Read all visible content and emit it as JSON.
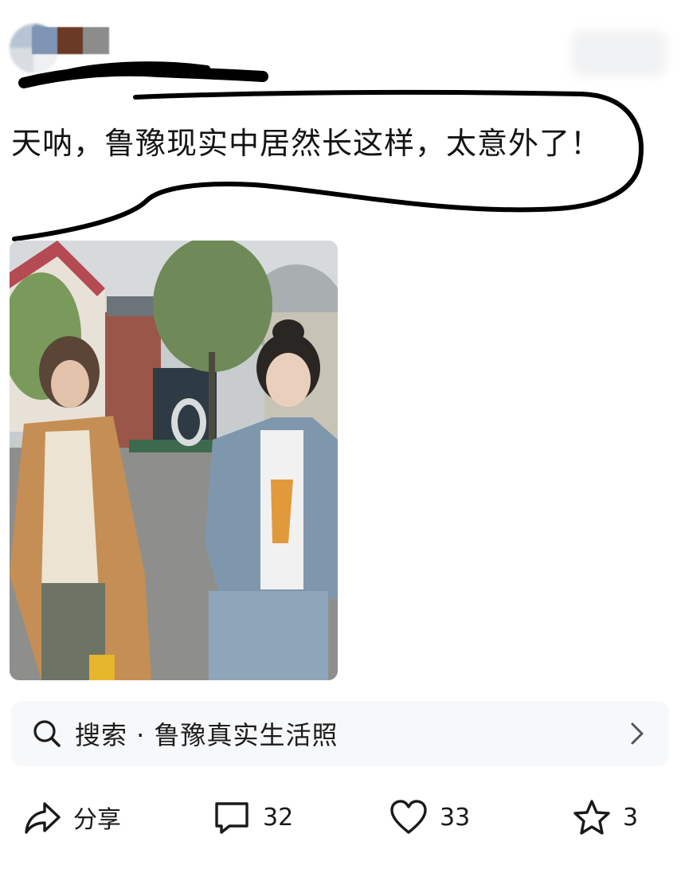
{
  "post": {
    "text": "天呐，鲁豫现实中居然长这样，太意外了！"
  },
  "search": {
    "label": "搜索 · 鲁豫真实生活照"
  },
  "actions": {
    "share_label": "分享",
    "comments_count": "32",
    "likes_count": "33",
    "favorites_count": "3"
  },
  "icons": {
    "search": "search-icon",
    "chevron": "chevron-right-icon",
    "share": "share-icon",
    "comment": "comment-icon",
    "like": "heart-icon",
    "favorite": "star-icon"
  },
  "colors": {
    "scribble": "#000000",
    "text": "#141414",
    "search_bg": "#f7f8fa"
  }
}
